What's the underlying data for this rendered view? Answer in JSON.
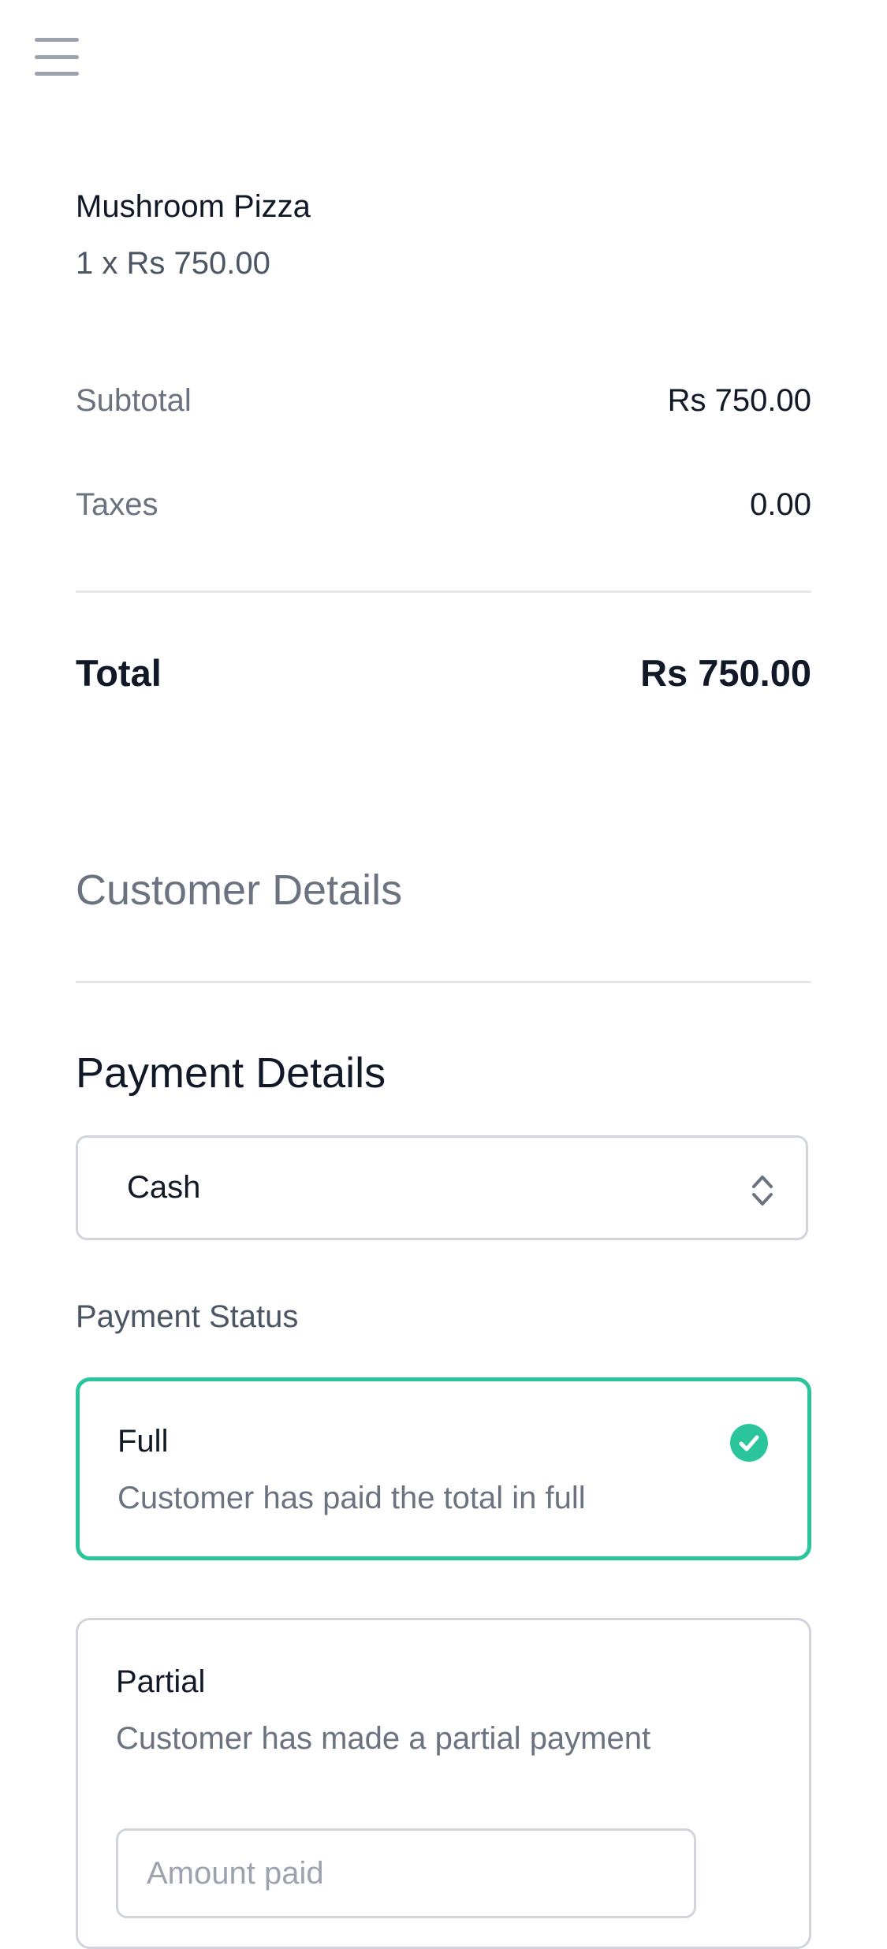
{
  "header": {
    "menu_icon": "hamburger-menu-icon"
  },
  "order": {
    "item_name": "Mushroom Pizza",
    "item_quantity_price": "1 x Rs 750.00"
  },
  "summary": {
    "subtotal_label": "Subtotal",
    "subtotal_value": "Rs 750.00",
    "taxes_label": "Taxes",
    "taxes_value": "0.00",
    "total_label": "Total",
    "total_value": "Rs 750.00"
  },
  "customer": {
    "title": "Customer Details"
  },
  "payment": {
    "title": "Payment Details",
    "method_selected": "Cash",
    "status_label": "Payment Status",
    "options": [
      {
        "title": "Full",
        "description": "Customer has paid the total in full",
        "selected": true
      },
      {
        "title": "Partial",
        "description": "Customer has made a partial payment",
        "selected": false
      }
    ],
    "amount_placeholder": "Amount paid"
  },
  "colors": {
    "accent": "#2bc59c",
    "text_primary": "#111827",
    "text_secondary": "#6b7280",
    "border": "#d1d5db"
  }
}
